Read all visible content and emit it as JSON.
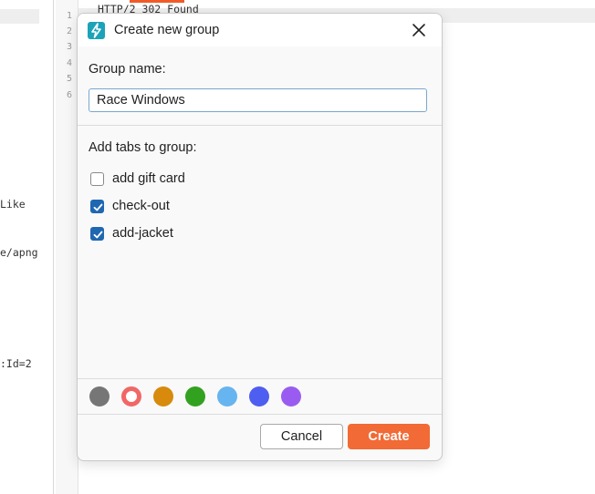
{
  "background": {
    "left_fragments": [
      "Like",
      "e/apng",
      ":Id=2"
    ],
    "line_numbers": [
      "1",
      "2",
      "3",
      "4",
      "5",
      "6"
    ],
    "first_line": "HTTP/2 302 Found"
  },
  "dialog": {
    "title": "Create new group",
    "group_name_label": "Group name:",
    "group_name_value": "Race Windows",
    "tabs_label": "Add tabs to group:",
    "tabs": [
      {
        "label": "add gift card",
        "checked": false
      },
      {
        "label": "check-out",
        "checked": true
      },
      {
        "label": "add-jacket",
        "checked": true
      }
    ],
    "colors": [
      {
        "name": "gray",
        "hex": "#767676",
        "selected": false
      },
      {
        "name": "red",
        "hex": "#f16766",
        "selected": true
      },
      {
        "name": "orange",
        "hex": "#d88a0c",
        "selected": false
      },
      {
        "name": "green",
        "hex": "#33a120",
        "selected": false
      },
      {
        "name": "light-blue",
        "hex": "#66b4f0",
        "selected": false
      },
      {
        "name": "blue",
        "hex": "#4d5ef0",
        "selected": false
      },
      {
        "name": "purple",
        "hex": "#9a5cf0",
        "selected": false
      }
    ],
    "cancel_label": "Cancel",
    "create_label": "Create"
  },
  "theme": {
    "accent": "#f26a35",
    "checkbox": "#1f67b1",
    "app_icon": "#1ba3b8"
  }
}
